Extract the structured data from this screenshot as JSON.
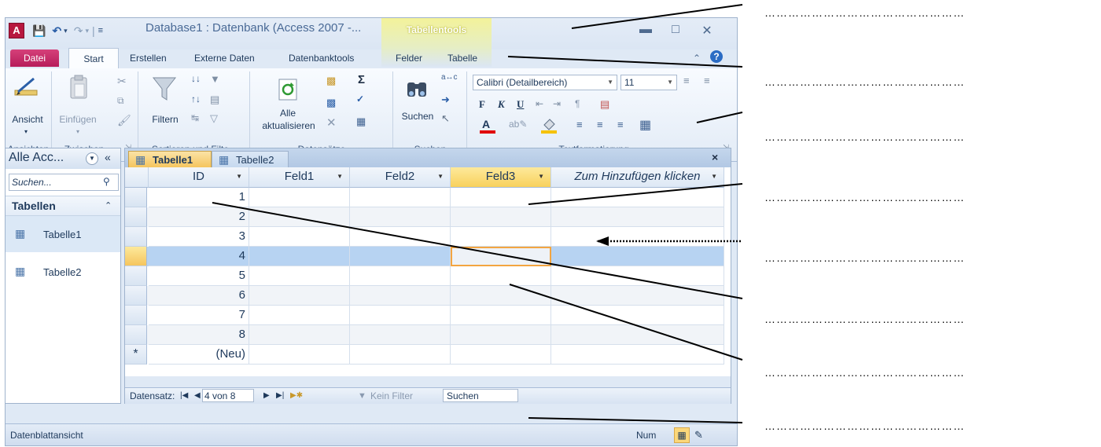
{
  "window": {
    "title": "Database1 : Datenbank (Access 2007 -...",
    "context_tab": "Tabellentools"
  },
  "tabs": [
    "Datei",
    "Start",
    "Erstellen",
    "Externe Daten",
    "Datenbanktools",
    "Felder",
    "Tabelle"
  ],
  "ribbon": {
    "ansicht": "Ansicht",
    "einfuegen": "Einfügen",
    "filtern": "Filtern",
    "alle": "Alle",
    "aktualisieren": "aktualisieren",
    "suchen": "Suchen",
    "font_name": "Calibri (Detailbereich)",
    "font_size": "11",
    "bold": "F",
    "italic": "K",
    "underline": "U",
    "groups": [
      "Ansichten",
      "Zwischen...",
      "Sortieren und Filte...",
      "Datensätze",
      "Suchen",
      "Textformatierung"
    ]
  },
  "nav": {
    "header": "Alle Acc...",
    "search_placeholder": "Suchen...",
    "group": "Tabellen",
    "items": [
      "Tabelle1",
      "Tabelle2"
    ]
  },
  "doc_tabs": [
    "Tabelle1",
    "Tabelle2"
  ],
  "columns": [
    "ID",
    "Feld1",
    "Feld2",
    "Feld3",
    "Zum Hinzufügen klicken"
  ],
  "rows": [
    "1",
    "2",
    "3",
    "4",
    "5",
    "6",
    "7",
    "8"
  ],
  "new_row": "(Neu)",
  "new_row_marker": "*",
  "record_nav": {
    "label": "Datensatz:",
    "position": "4 von 8",
    "filter": "Kein Filter",
    "search": "Suchen"
  },
  "status": {
    "view": "Datenblattansicht",
    "num": "Num"
  },
  "answer_lines": [
    "……………………………………………",
    "……………………………………………",
    "……………………………………………",
    "……………………………………………",
    "……………………………………………",
    "……………………………………………",
    "……………………………………………",
    "……………………………………………",
    "……………………………………………"
  ],
  "colors": {
    "accent": "#2b579a",
    "datei": "#b71d5a",
    "selected_row": "#b7d3f2",
    "active_cell_border": "#f3a541",
    "context_tab": "#f3f29a"
  }
}
